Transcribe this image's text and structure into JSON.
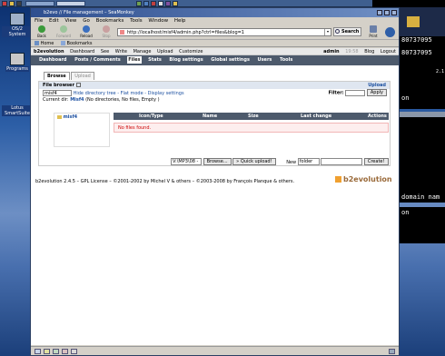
{
  "desktop": {
    "icons": [
      {
        "label": "OS/2 System"
      },
      {
        "label": "Programs"
      },
      {
        "label": "Lotus SmartSuite"
      }
    ],
    "terminal_lines": [
      "80737095",
      "80737095",
      "on",
      "domain nam",
      "on"
    ],
    "terminal_side_text": "2.1"
  },
  "window": {
    "title": "b2evo // File management – SeaMonkey",
    "menu": [
      "File",
      "Edit",
      "View",
      "Go",
      "Bookmarks",
      "Tools",
      "Window",
      "Help"
    ],
    "nav": {
      "back": "Back",
      "forward": "Forward",
      "reload": "Reload",
      "stop": "Stop",
      "print": "Print"
    },
    "url": "http://localhost/misf4/admin.php?ctrl=files&blog=1",
    "search_label": "Search",
    "bookmarks": {
      "home": "Home",
      "bookmarks": "Bookmarks"
    }
  },
  "admin": {
    "top_links": [
      "b2evolution",
      "Dashboard",
      "See",
      "Write",
      "Manage",
      "Upload",
      "Customize"
    ],
    "user": "admin",
    "time": "19:58",
    "blog_label": "Blog",
    "logout": "Logout",
    "tabs": [
      "Dashboard",
      "Posts / Comments",
      "Files",
      "Stats",
      "Blog settings",
      "Global settings",
      "Users",
      "Tools"
    ],
    "active_tab": "Files",
    "subtabs": [
      "Browse",
      "Upload"
    ],
    "active_subtab": "Browse"
  },
  "file_browser": {
    "title": "File browser",
    "upload_link": "Upload",
    "root_select": "misf4",
    "options_links": "Hide directory tree - Flat mode - Display settings",
    "current_dir_label": "Current dir:",
    "current_dir": "Misf4",
    "current_dir_info": "(No directories, No files, Empty )",
    "filter_label": "Filter:",
    "apply_button": "Apply",
    "tree_item": "misf4",
    "columns": [
      "Icon/Type",
      "Name",
      "Size",
      "Last change",
      "Actions"
    ],
    "empty_message": "No files found.",
    "path_value": "V:\\MP3\\08 -",
    "browse_button": "Browse...",
    "quick_upload_button": "» Quick upload!",
    "new_label": "New",
    "new_type": "folder",
    "create_button": "Create!"
  },
  "footer": {
    "text": "b2evolution 2.4.5 – GPL License – ©2001-2002 by Michel V & others – ©2003-2008 by François Planque & others.",
    "logo": "b2evolution"
  },
  "colors": {
    "tab_bar": "#4d5a6c",
    "link": "#1b4fa0",
    "error": "#cc0000"
  }
}
